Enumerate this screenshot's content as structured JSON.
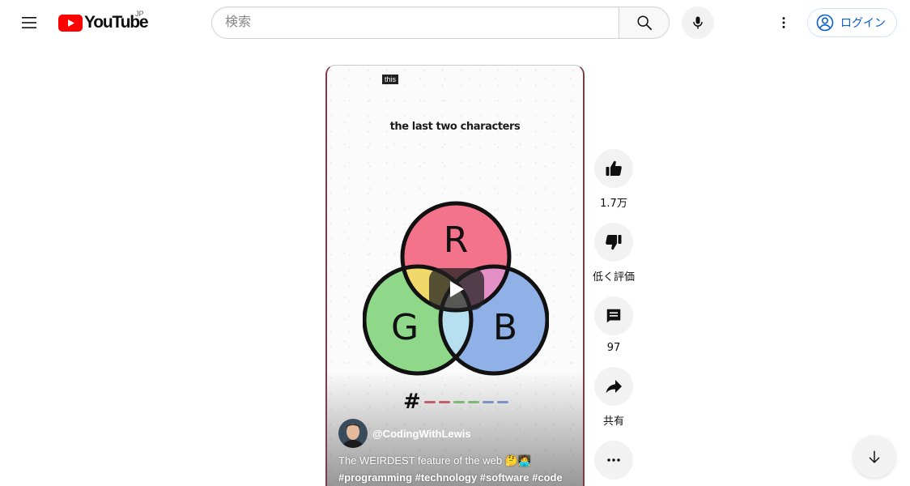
{
  "header": {
    "logo_text": "YouTube",
    "region": "JP",
    "search_placeholder": "検索",
    "signin_label": "ログイン"
  },
  "video": {
    "caption_box": "this",
    "overlay_text": "the last two characters",
    "venn_letters": [
      "R",
      "G",
      "B"
    ],
    "hash_symbol": "#",
    "channel_name": "@CodingWithLewis",
    "title": "The WEIRDEST feature of the web 🤔🧑‍💻",
    "hashtags": "#programming #technology #software #code",
    "icons": [
      "play-icon"
    ]
  },
  "actions": {
    "like_count": "1.7万",
    "dislike_label": "低く評価",
    "comment_count": "97",
    "share_label": "共有"
  },
  "colors": {
    "youtube_red": "#ff0000",
    "signin_blue": "#065fd4",
    "venn_red": "#f2738a",
    "venn_green": "#8fd88a",
    "venn_blue": "#8fb1e8"
  }
}
